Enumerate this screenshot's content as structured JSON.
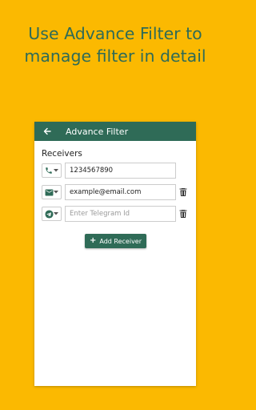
{
  "headline": {
    "line1": "Use Advance Filter to",
    "line2": "manage filter in detail"
  },
  "appbar": {
    "title": "Advance Filter",
    "back_icon": "arrow-left-icon"
  },
  "receivers": {
    "title": "Receivers",
    "rows": [
      {
        "type_icon": "phone-icon",
        "value": "1234567890",
        "placeholder": "",
        "deletable": false
      },
      {
        "type_icon": "email-icon",
        "value": "example@email.com",
        "placeholder": "",
        "deletable": true
      },
      {
        "type_icon": "telegram-icon",
        "value": "",
        "placeholder": "Enter Telegram Id",
        "deletable": true
      }
    ]
  },
  "add_button": {
    "icon": "plus",
    "label": "Add Receiver"
  },
  "colors": {
    "background": "#FBB901",
    "primary": "#2F6B57",
    "card": "#FFFFFF"
  }
}
